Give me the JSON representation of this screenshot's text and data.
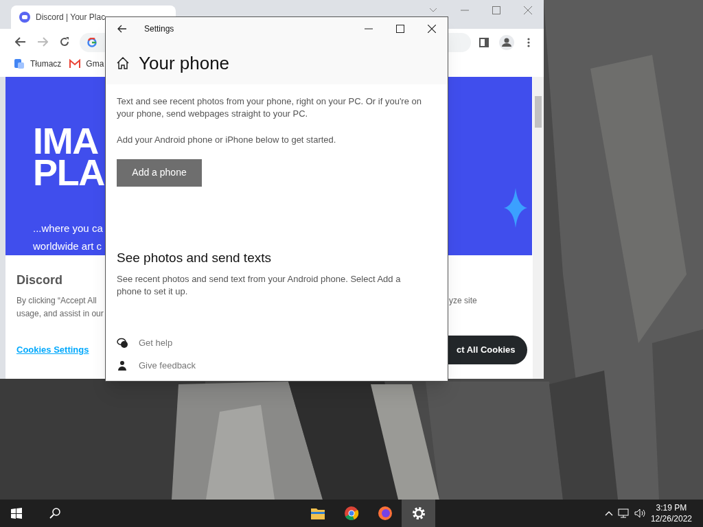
{
  "browser": {
    "tab_title": "Discord | Your Plac",
    "bookmarks": [
      "Tłumacz",
      "Gma"
    ],
    "page": {
      "hero_lines": [
        "IMA",
        "PLA"
      ],
      "hero_sub_lines": [
        "...where you ca",
        "worldwide art c"
      ],
      "cookie_title": "Discord",
      "cookie_text_left": [
        "By clicking “Accept All",
        "usage, and assist in our"
      ],
      "cookie_text_right": "yze site",
      "cookies_settings": "Cookies Settings",
      "accept_button": "ct All Cookies"
    }
  },
  "settings": {
    "title": "Settings",
    "heading": "Your phone",
    "intro": "Text and see recent photos from your phone, right on your PC. Or if you're on your phone, send webpages straight to your PC.",
    "prompt": "Add your Android phone or iPhone below to get started.",
    "add_button": "Add a phone",
    "section_title": "See photos and send texts",
    "section_text": "See recent photos and send text from your Android phone. Select Add a phone to set it up.",
    "links": [
      {
        "kind": "help",
        "label": "Get help"
      },
      {
        "kind": "feedback",
        "label": "Give feedback"
      }
    ]
  },
  "taskbar": {
    "apps": [
      {
        "kind": "explorer",
        "selected": false
      },
      {
        "kind": "chrome",
        "selected": false
      },
      {
        "kind": "firefox",
        "selected": false
      },
      {
        "kind": "settings",
        "selected": true
      }
    ],
    "time": "3:19 PM",
    "date": "12/26/2022"
  }
}
